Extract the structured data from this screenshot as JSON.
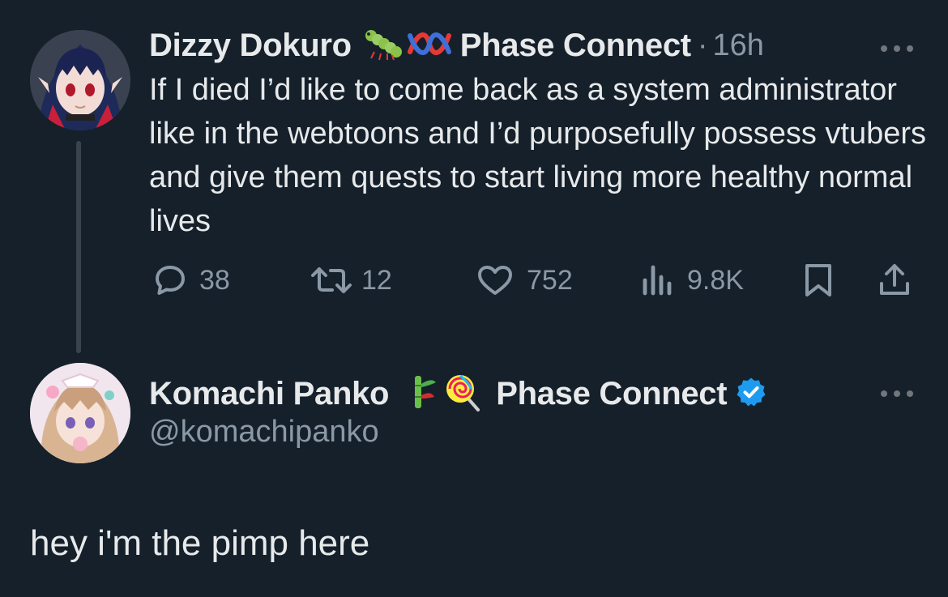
{
  "tweet": {
    "author": "Dizzy Dokuro",
    "author_emojis": [
      "caterpillar-emoji",
      "knot-emoji"
    ],
    "affiliation": "Phase Connect",
    "separator": "·",
    "time": "16h",
    "text": "If I died I’d like to come back as a system administrator like in the webtoons and I’d purposefully possess vtubers and give them quests to start living more healthy normal lives",
    "stats": {
      "replies": "38",
      "retweets": "12",
      "likes": "752",
      "views": "9.8K"
    },
    "icons": [
      "reply-icon",
      "retweet-icon",
      "like-icon",
      "views-icon",
      "bookmark-icon",
      "share-icon"
    ]
  },
  "reply": {
    "author": "Komachi Panko",
    "author_emojis": [
      "bamboo-emoji",
      "lollipop-emoji"
    ],
    "affiliation": "Phase Connect",
    "verified": true,
    "handle": "@komachipanko",
    "text": "hey i'm the pimp here"
  },
  "colors": {
    "background": "#15202b",
    "text": "#e7e9ea",
    "muted": "#8b98a5",
    "verified": "#1d9bf0"
  }
}
